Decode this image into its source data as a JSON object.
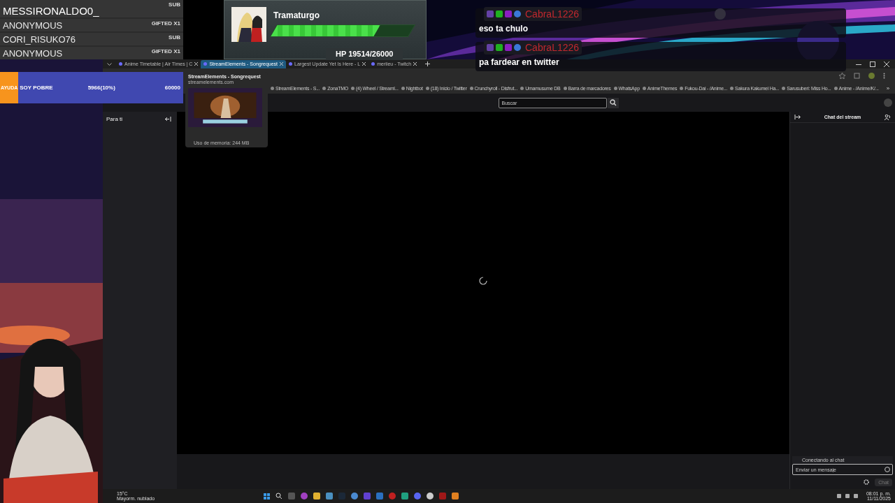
{
  "subs": [
    {
      "name": "MESSIRONALDO0_",
      "type": "SUB"
    },
    {
      "name": "ANONYMOUS",
      "type": "GIFTED X1"
    },
    {
      "name": "CORI_RISUKO76",
      "type": "SUB"
    },
    {
      "name": "ANONYMOUS",
      "type": "GIFTED X1"
    }
  ],
  "boss": {
    "name": "Tramaturgo",
    "level": 0.75,
    "hp": "HP 19514/26000"
  },
  "goal": {
    "label": "AYUDA",
    "title": "SOY POBRE",
    "current": "5966(10%)",
    "target": "60000",
    "level": 0.1
  },
  "chat_overlay": [
    {
      "user": "CabraL1226",
      "color": "#c0282e",
      "text": "eso ta chulo"
    },
    {
      "user": "CabraL1226",
      "color": "#c0282e",
      "text": "pa fardear en twitter"
    }
  ],
  "tabs": [
    {
      "title": "Anime Timetable | Air Times | C",
      "selected": false
    },
    {
      "title": "StreamElements - Songrequest",
      "selected": true
    },
    {
      "title": "Largest Update Yet Is Here - L",
      "selected": false
    },
    {
      "title": "meriieu - Twitch",
      "selected": false
    }
  ],
  "tab_preview": {
    "title": "StreamElements - Songrequest",
    "url": "streamelements.com",
    "memory": "Uso de memoria: 244 MB"
  },
  "bookmarks": [
    "StreamElements - S...",
    "ZonaTMO",
    "(4) Wheel / Streaml...",
    "Nightbot",
    "(18) Inicio / Twitter",
    "Crunchyroll - Disfrut...",
    "Umamusume DB",
    "Barra de marcadores",
    "WhatsApp",
    "AnimeThemes",
    "Fukou-Dai - /Anime...",
    "Sakura Kakumei Ha...",
    "Sarusuberi: Miss Ho...",
    "Anime - /Anime/K/..."
  ],
  "bookmarks_more": "»",
  "search": {
    "placeholder": "Buscar"
  },
  "sidebar": {
    "title": "Para ti"
  },
  "chat_panel": {
    "title": "Chat del stream",
    "status": "Conectando al chat",
    "placeholder": "Enviar un mensaje",
    "send": "Chat"
  },
  "taskbar": {
    "temperature": "15°C",
    "weather": "Mayorm. nublado",
    "time": "08:01 p. m.",
    "date": "11/11/2025"
  }
}
